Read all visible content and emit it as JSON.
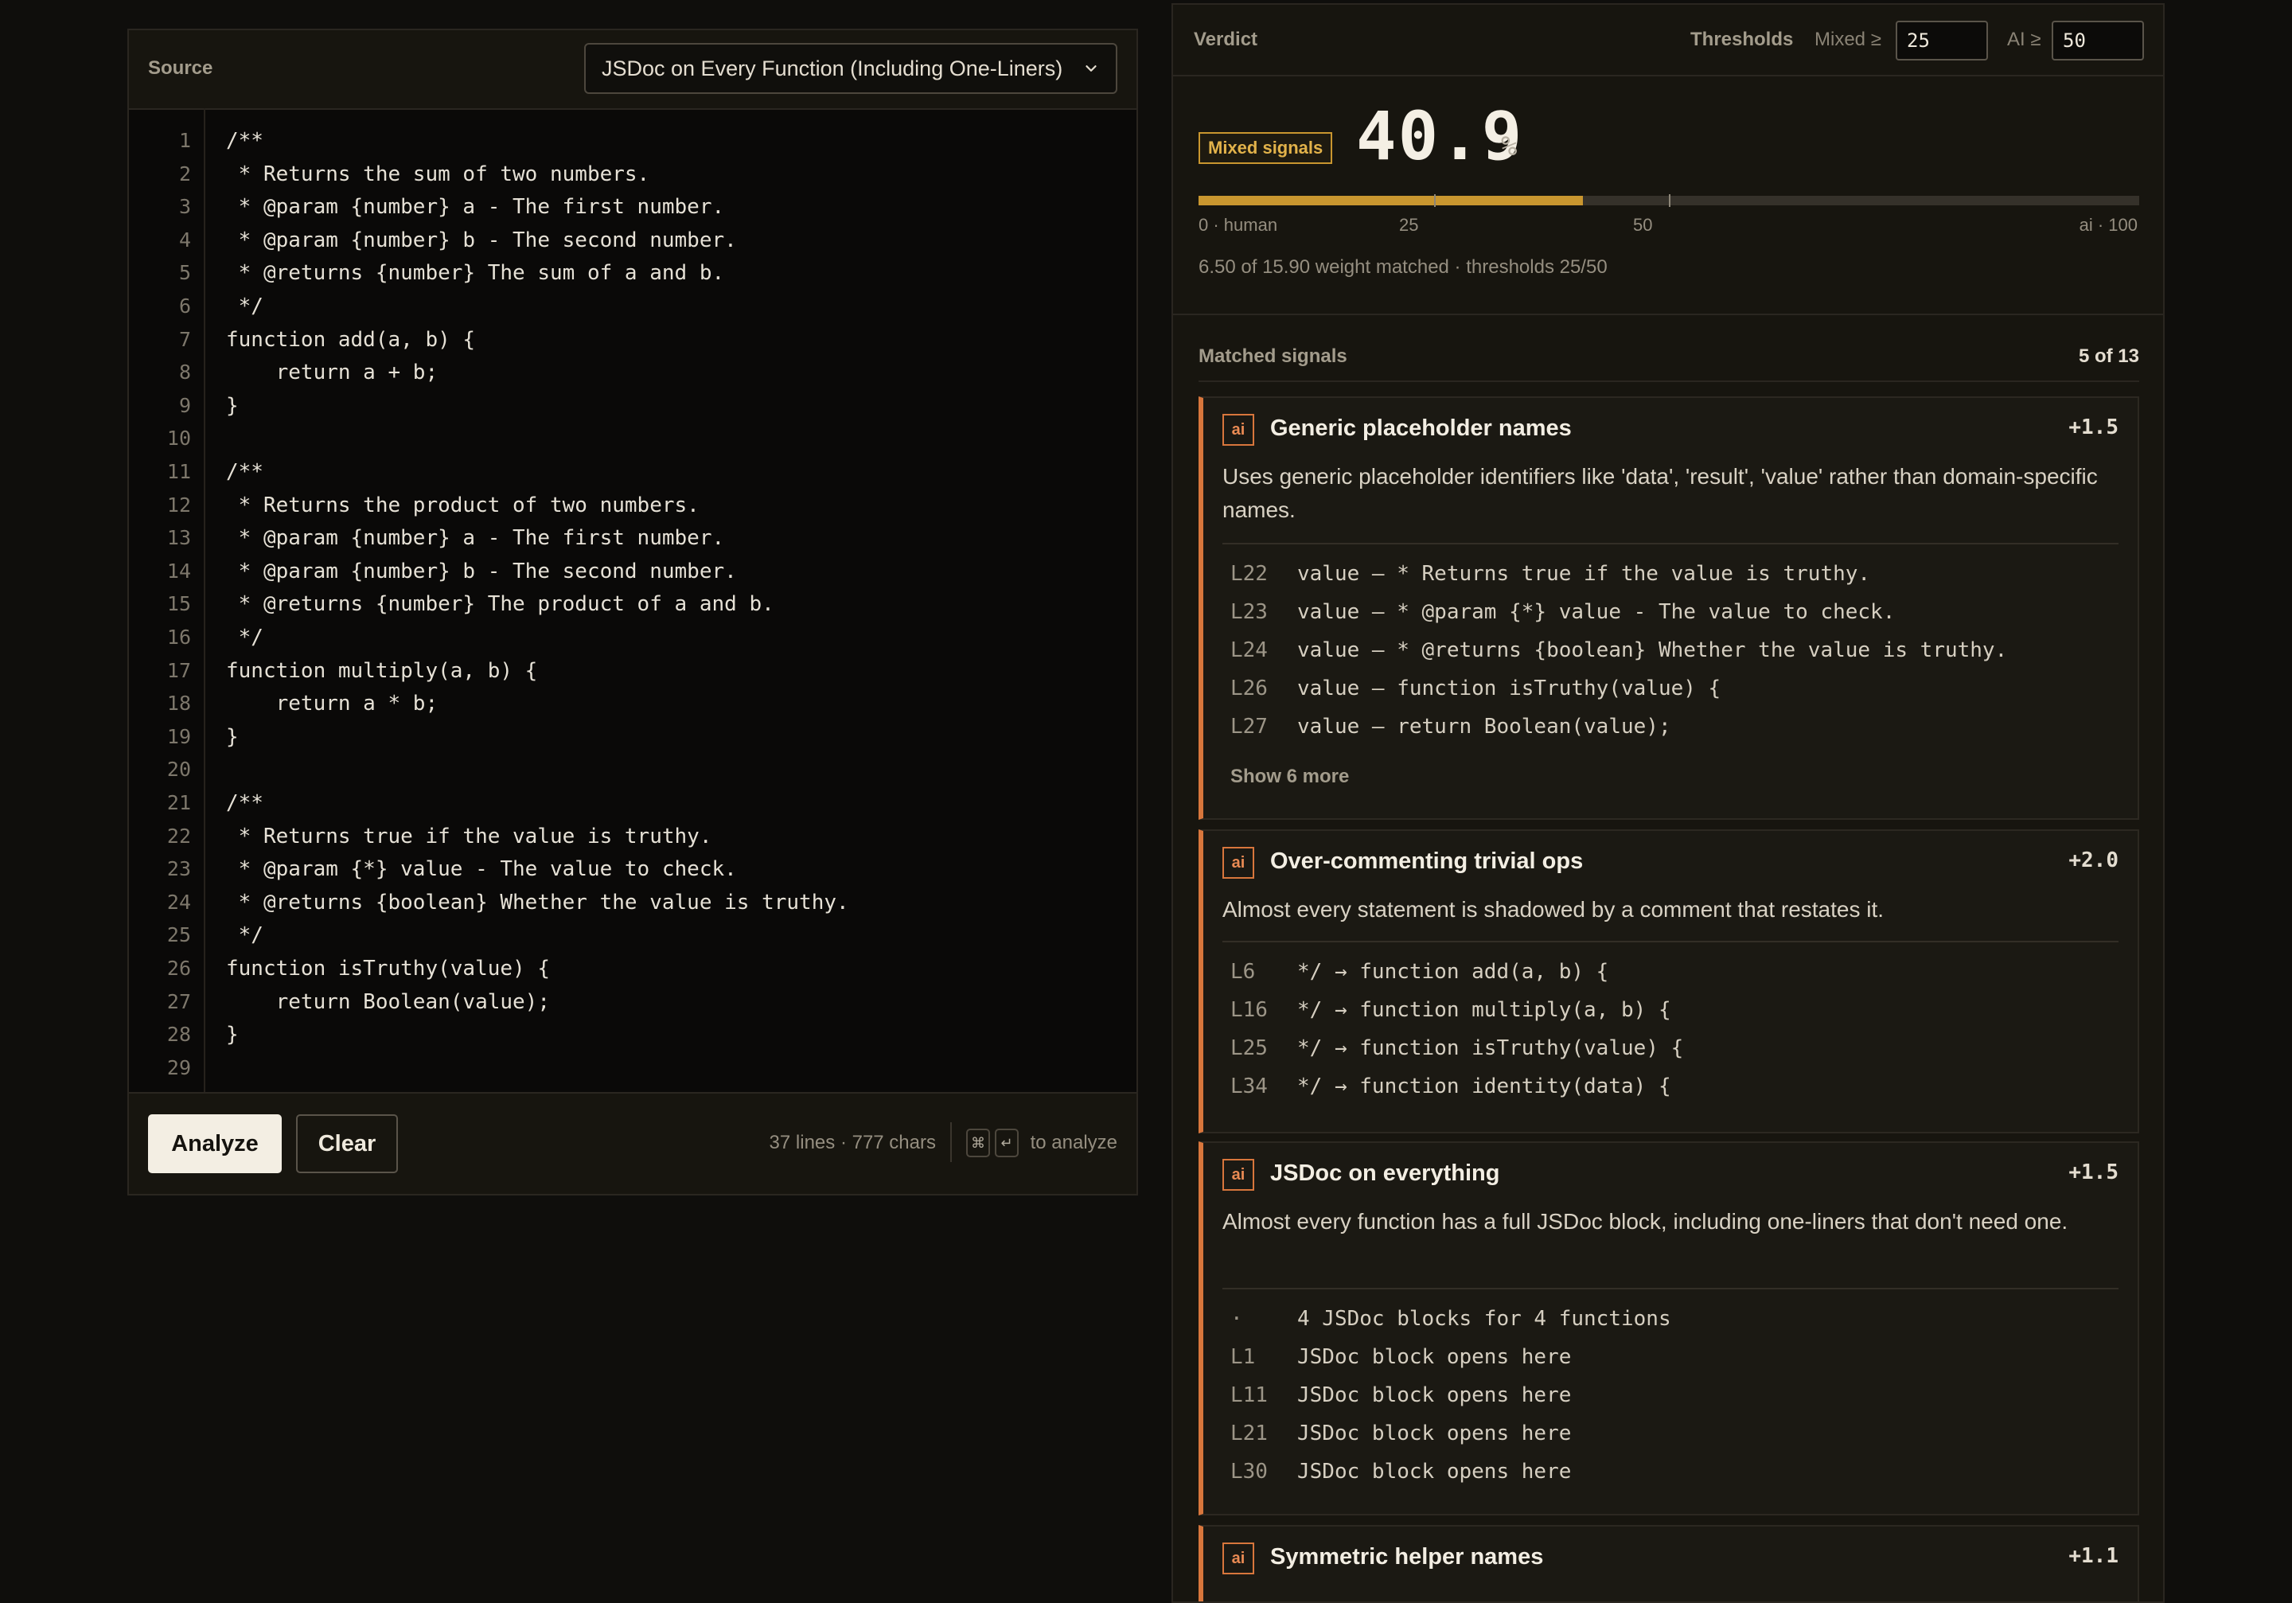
{
  "source": {
    "title": "Source",
    "sample_select": "JSDoc on Every Function (Including One-Liners)",
    "lines": [
      {
        "n": "1",
        "text": "/**"
      },
      {
        "n": "2",
        "text": " * Returns the sum of two numbers."
      },
      {
        "n": "3",
        "text": " * @param {number} a - The first number."
      },
      {
        "n": "4",
        "text": " * @param {number} b - The second number."
      },
      {
        "n": "5",
        "text": " * @returns {number} The sum of a and b."
      },
      {
        "n": "6",
        "text": " */"
      },
      {
        "n": "7",
        "text": "function add(a, b) {"
      },
      {
        "n": "8",
        "text": "    return a + b;"
      },
      {
        "n": "9",
        "text": "}"
      },
      {
        "n": "10",
        "text": ""
      },
      {
        "n": "11",
        "text": "/**"
      },
      {
        "n": "12",
        "text": " * Returns the product of two numbers."
      },
      {
        "n": "13",
        "text": " * @param {number} a - The first number."
      },
      {
        "n": "14",
        "text": " * @param {number} b - The second number."
      },
      {
        "n": "15",
        "text": " * @returns {number} The product of a and b."
      },
      {
        "n": "16",
        "text": " */"
      },
      {
        "n": "17",
        "text": "function multiply(a, b) {"
      },
      {
        "n": "18",
        "text": "    return a * b;"
      },
      {
        "n": "19",
        "text": "}"
      },
      {
        "n": "20",
        "text": ""
      },
      {
        "n": "21",
        "text": "/**"
      },
      {
        "n": "22",
        "text": " * Returns true if the value is truthy."
      },
      {
        "n": "23",
        "text": " * @param {*} value - The value to check."
      },
      {
        "n": "24",
        "text": " * @returns {boolean} Whether the value is truthy."
      },
      {
        "n": "25",
        "text": " */"
      },
      {
        "n": "26",
        "text": "function isTruthy(value) {"
      },
      {
        "n": "27",
        "text": "    return Boolean(value);"
      },
      {
        "n": "28",
        "text": "}"
      },
      {
        "n": "29",
        "text": ""
      }
    ],
    "footer": {
      "analyze_label": "Analyze",
      "clear_label": "Clear",
      "stats": "37 lines · 777 chars",
      "kbd_cmd": "⌘",
      "kbd_enter": "↵",
      "hint": "to analyze"
    }
  },
  "verdict": {
    "title": "Verdict",
    "thresholds_label": "Thresholds",
    "mixed_label": "Mixed ≥",
    "mixed_value": "25",
    "ai_label": "AI ≥",
    "ai_value": "50",
    "badge": "Mixed signals",
    "score": "40.9",
    "score_unit": "%",
    "score_fraction": 0.409,
    "meter_labels": {
      "human": "0 · human",
      "t25": "25",
      "t50": "50",
      "ai": "ai · 100"
    },
    "weight_text": "6.50 of 15.90 weight matched · thresholds 25/50",
    "accent_color": "#c9962f"
  },
  "signals": {
    "title": "Matched signals",
    "count": "5 of 13",
    "items": [
      {
        "tag": "ai",
        "name": "Generic placeholder names",
        "weight": "+1.5",
        "description": "Uses generic placeholder identifiers like 'data', 'result', 'value' rather than domain-specific names.",
        "evidence": [
          {
            "line": "L22",
            "text": "value — * Returns true if the value is truthy."
          },
          {
            "line": "L23",
            "text": "value — * @param {*} value - The value to check."
          },
          {
            "line": "L24",
            "text": "value — * @returns {boolean} Whether the value is truthy."
          },
          {
            "line": "L26",
            "text": "value — function isTruthy(value) {"
          },
          {
            "line": "L27",
            "text": "value — return Boolean(value);"
          }
        ],
        "show_more": "Show 6 more"
      },
      {
        "tag": "ai",
        "name": "Over-commenting trivial ops",
        "weight": "+2.0",
        "description": "Almost every statement is shadowed by a comment that restates it.",
        "evidence": [
          {
            "line": "L6",
            "text": "*/ → function add(a, b) {"
          },
          {
            "line": "L16",
            "text": "*/ → function multiply(a, b) {"
          },
          {
            "line": "L25",
            "text": "*/ → function isTruthy(value) {"
          },
          {
            "line": "L34",
            "text": "*/ → function identity(data) {"
          }
        ]
      },
      {
        "tag": "ai",
        "name": "JSDoc on everything",
        "weight": "+1.5",
        "description": "Almost every function has a full JSDoc block, including one-liners that don't need one.",
        "evidence": [
          {
            "line": "·",
            "text": "4 JSDoc blocks for 4 functions"
          },
          {
            "line": "L1",
            "text": "JSDoc block opens here"
          },
          {
            "line": "L11",
            "text": "JSDoc block opens here"
          },
          {
            "line": "L21",
            "text": "JSDoc block opens here"
          },
          {
            "line": "L30",
            "text": "JSDoc block opens here"
          }
        ]
      },
      {
        "tag": "ai",
        "name": "Symmetric helper names",
        "weight": "+1.1"
      }
    ]
  }
}
